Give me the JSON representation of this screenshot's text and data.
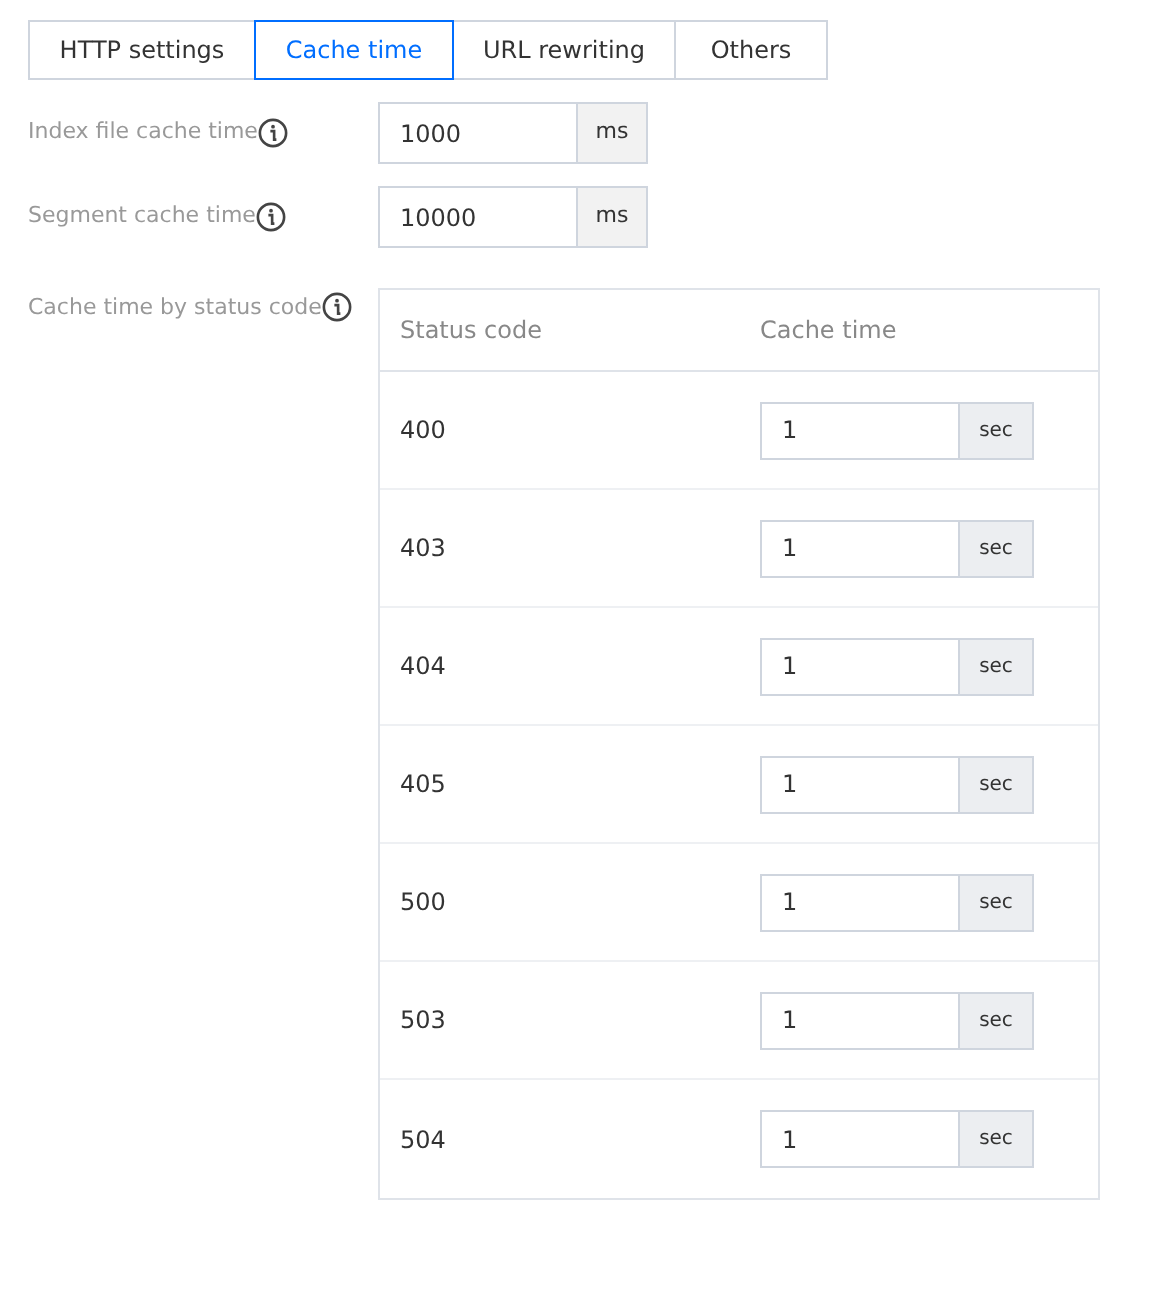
{
  "tabs": [
    {
      "label": "HTTP settings",
      "selected": false
    },
    {
      "label": "Cache time",
      "selected": true
    },
    {
      "label": "URL rewriting",
      "selected": false
    },
    {
      "label": "Others",
      "selected": false
    }
  ],
  "fields": [
    {
      "label": "Index file cache time",
      "value": "1000",
      "unit": "ms"
    },
    {
      "label": "Segment cache time",
      "value": "10000",
      "unit": "ms"
    }
  ],
  "status_table": {
    "label": "Cache time by status code",
    "columns": [
      "Status code",
      "Cache time"
    ],
    "rows": [
      {
        "code": "400",
        "value": "1",
        "unit": "sec"
      },
      {
        "code": "403",
        "value": "1",
        "unit": "sec"
      },
      {
        "code": "404",
        "value": "1",
        "unit": "sec"
      },
      {
        "code": "405",
        "value": "1",
        "unit": "sec"
      },
      {
        "code": "500",
        "value": "1",
        "unit": "sec"
      },
      {
        "code": "503",
        "value": "1",
        "unit": "sec"
      },
      {
        "code": "504",
        "value": "1",
        "unit": "sec"
      }
    ]
  }
}
